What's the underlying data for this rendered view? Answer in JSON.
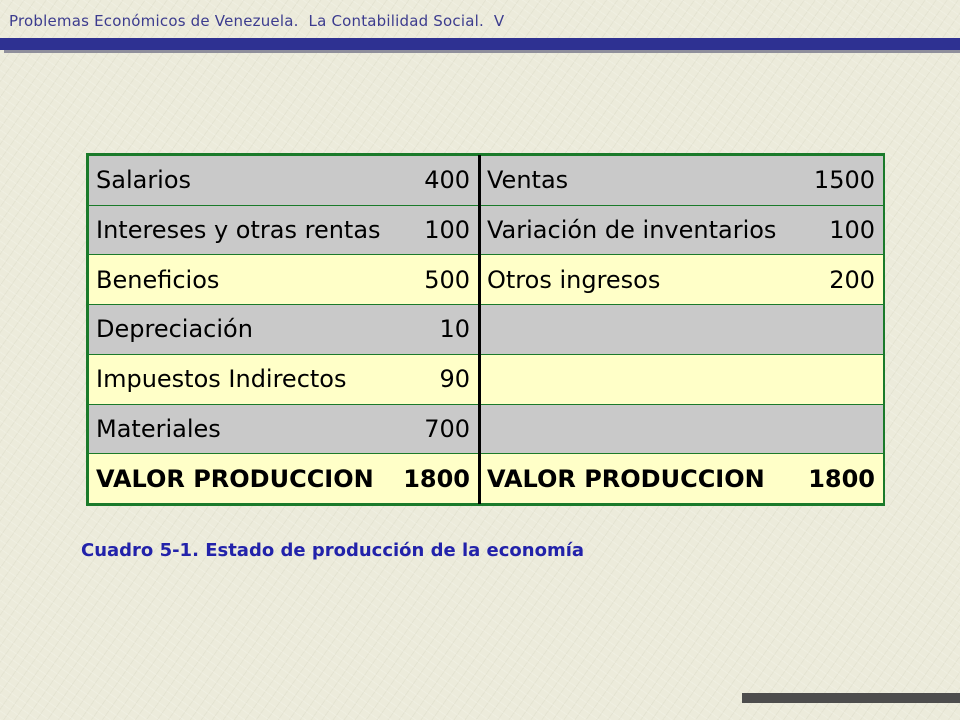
{
  "header": {
    "text": "Problemas Económicos de Venezuela.  La Contabilidad Social.  V"
  },
  "table": {
    "rows": [
      {
        "style": "gray",
        "left_label": "Salarios",
        "left_value": "400",
        "right_label": "Ventas",
        "right_value": "1500"
      },
      {
        "style": "gray",
        "left_label": "Intereses y otras rentas",
        "left_value": "100",
        "right_label": "Variación de inventarios",
        "right_value": "100"
      },
      {
        "style": "yellow",
        "left_label": "Beneficios",
        "left_value": "500",
        "right_label": "Otros ingresos",
        "right_value": "200"
      },
      {
        "style": "gray",
        "left_label": "Depreciación",
        "left_value": "10",
        "right_label": "",
        "right_value": ""
      },
      {
        "style": "yellow",
        "left_label": "Impuestos Indirectos",
        "left_value": "90",
        "right_label": "",
        "right_value": ""
      },
      {
        "style": "gray",
        "left_label": "Materiales",
        "left_value": "700",
        "right_label": "",
        "right_value": ""
      },
      {
        "style": "yellow",
        "left_label": "VALOR PRODUCCION",
        "left_value": "1800",
        "right_label": "VALOR PRODUCCION",
        "right_value": "1800"
      }
    ]
  },
  "caption": "Cuadro 5-1. Estado de producción de la economía",
  "colors": {
    "header_bar": "#2e3192",
    "header_text": "#3c3c8e",
    "table_border": "#1a7a2a",
    "row_gray": "#c9c9c9",
    "row_yellow": "#ffffc8",
    "caption": "#2222aa"
  }
}
